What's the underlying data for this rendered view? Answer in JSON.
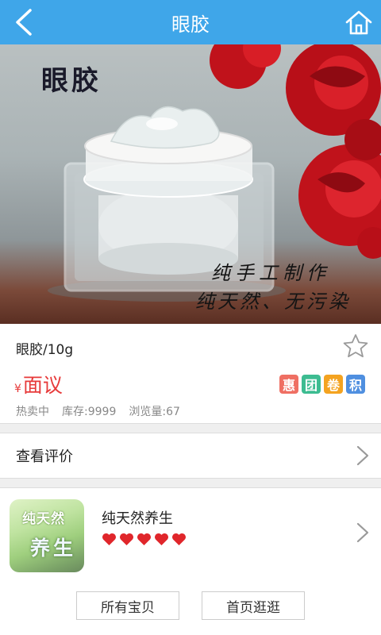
{
  "header": {
    "title": "眼胶"
  },
  "hero": {
    "caption_title": "眼胶",
    "caption_line1": "纯手工制作",
    "caption_line2": "纯天然、无污染"
  },
  "product": {
    "name": "眼胶/10g",
    "currency_symbol": "¥",
    "price": "面议",
    "badges": [
      {
        "text": "惠",
        "color": "#ef6f63"
      },
      {
        "text": "团",
        "color": "#3dbc91"
      },
      {
        "text": "卷",
        "color": "#f4a320"
      },
      {
        "text": "积",
        "color": "#4f8fe0"
      }
    ],
    "stats": {
      "status": "热卖中",
      "stock": "库存:9999",
      "views": "浏览量:67"
    }
  },
  "reviews": {
    "label": "查看评价"
  },
  "shop": {
    "logo_line1": "纯天然",
    "logo_line2": "养生",
    "name": "纯天然养生",
    "rating_hearts": 5,
    "buttons": {
      "all_items": "所有宝贝",
      "home": "首页逛逛"
    }
  },
  "colors": {
    "header": "#3fa6e9",
    "price": "#e73a3a",
    "heart": "#e0262b"
  }
}
